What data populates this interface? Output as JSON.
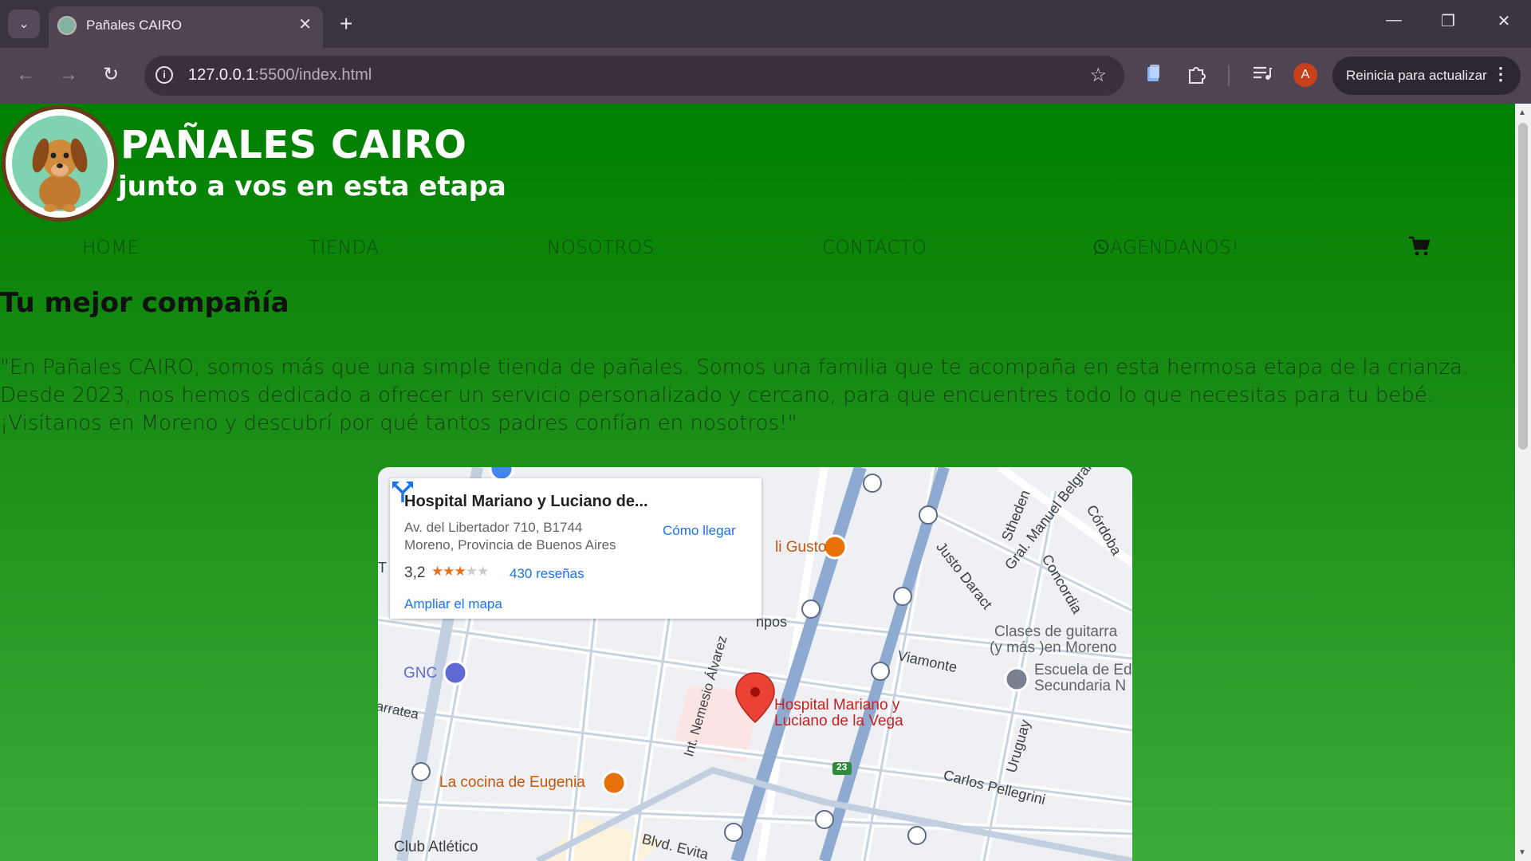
{
  "browser": {
    "tab_title": "Pañales CAIRO",
    "url_host": "127.0.0.1",
    "url_path": ":5500/index.html",
    "restart_label": "Reinicia para actualizar",
    "profile_initial": "A"
  },
  "header": {
    "brand": "PAÑALES CAIRO",
    "tagline": "junto a vos en esta etapa"
  },
  "nav": {
    "home": "HOME",
    "tienda": "TIENDA",
    "nosotros": "NOSOTROS",
    "contacto": "CONTACTO",
    "agendanos": "AGENDANOS!"
  },
  "main": {
    "title": "Tu mejor compañía",
    "intro": "\"En Pañales CAIRO, somos más que una simple tienda de pañales. Somos una familia que te acompaña en esta hermosa etapa de la crianza. Desde 2023, nos hemos dedicado a ofrecer un servicio personalizado y cercano, para que encuentres todo lo que necesitas para tu bebé. ¡Visítanos en Moreno y descubrí por qué tantos padres confían en nosotros!\""
  },
  "map": {
    "place_name": "Hospital Mariano y Luciano de...",
    "address_line1": "Av. del Libertador 710, B1744",
    "address_line2": "Moreno, Provincia de Buenos Aires",
    "rating": "3,2",
    "rating_value": 3.2,
    "reviews": "430 reseñas",
    "enlarge": "Ampliar el mapa",
    "directions": "Cómo llegar",
    "labels": {
      "gusto": "li Gusto",
      "justo": "Justo Daract",
      "gral": "Gral. Manuel Belgrano",
      "sthed": "Stheden",
      "cordoba": "Córdoba",
      "concordia": "Concordia",
      "clases1": "Clases de guitarra",
      "clases2": "(y más )en Moreno",
      "escuela1": "Escuela de Ed",
      "escuela2": "Secundaria N",
      "viamonte": "Viamonte",
      "uruguay": "Uruguay",
      "hospital1": "Hospital Mariano y",
      "hospital2": "Luciano de la Vega",
      "route": "23",
      "carlos": "Carlos Pellegrini",
      "nemesio": "Int. Nemesio Álvarez",
      "gnc": "GNC",
      "arratea": "arratea",
      "cocina": "La cocina de Eugenia",
      "club": "Club Atlético",
      "evita": "Blvd. Evita",
      "pos": "npos",
      "t": "T"
    }
  },
  "colors": {
    "page_green": "#008000",
    "map_pin": "#ea4335",
    "map_link": "#1a73e8"
  }
}
